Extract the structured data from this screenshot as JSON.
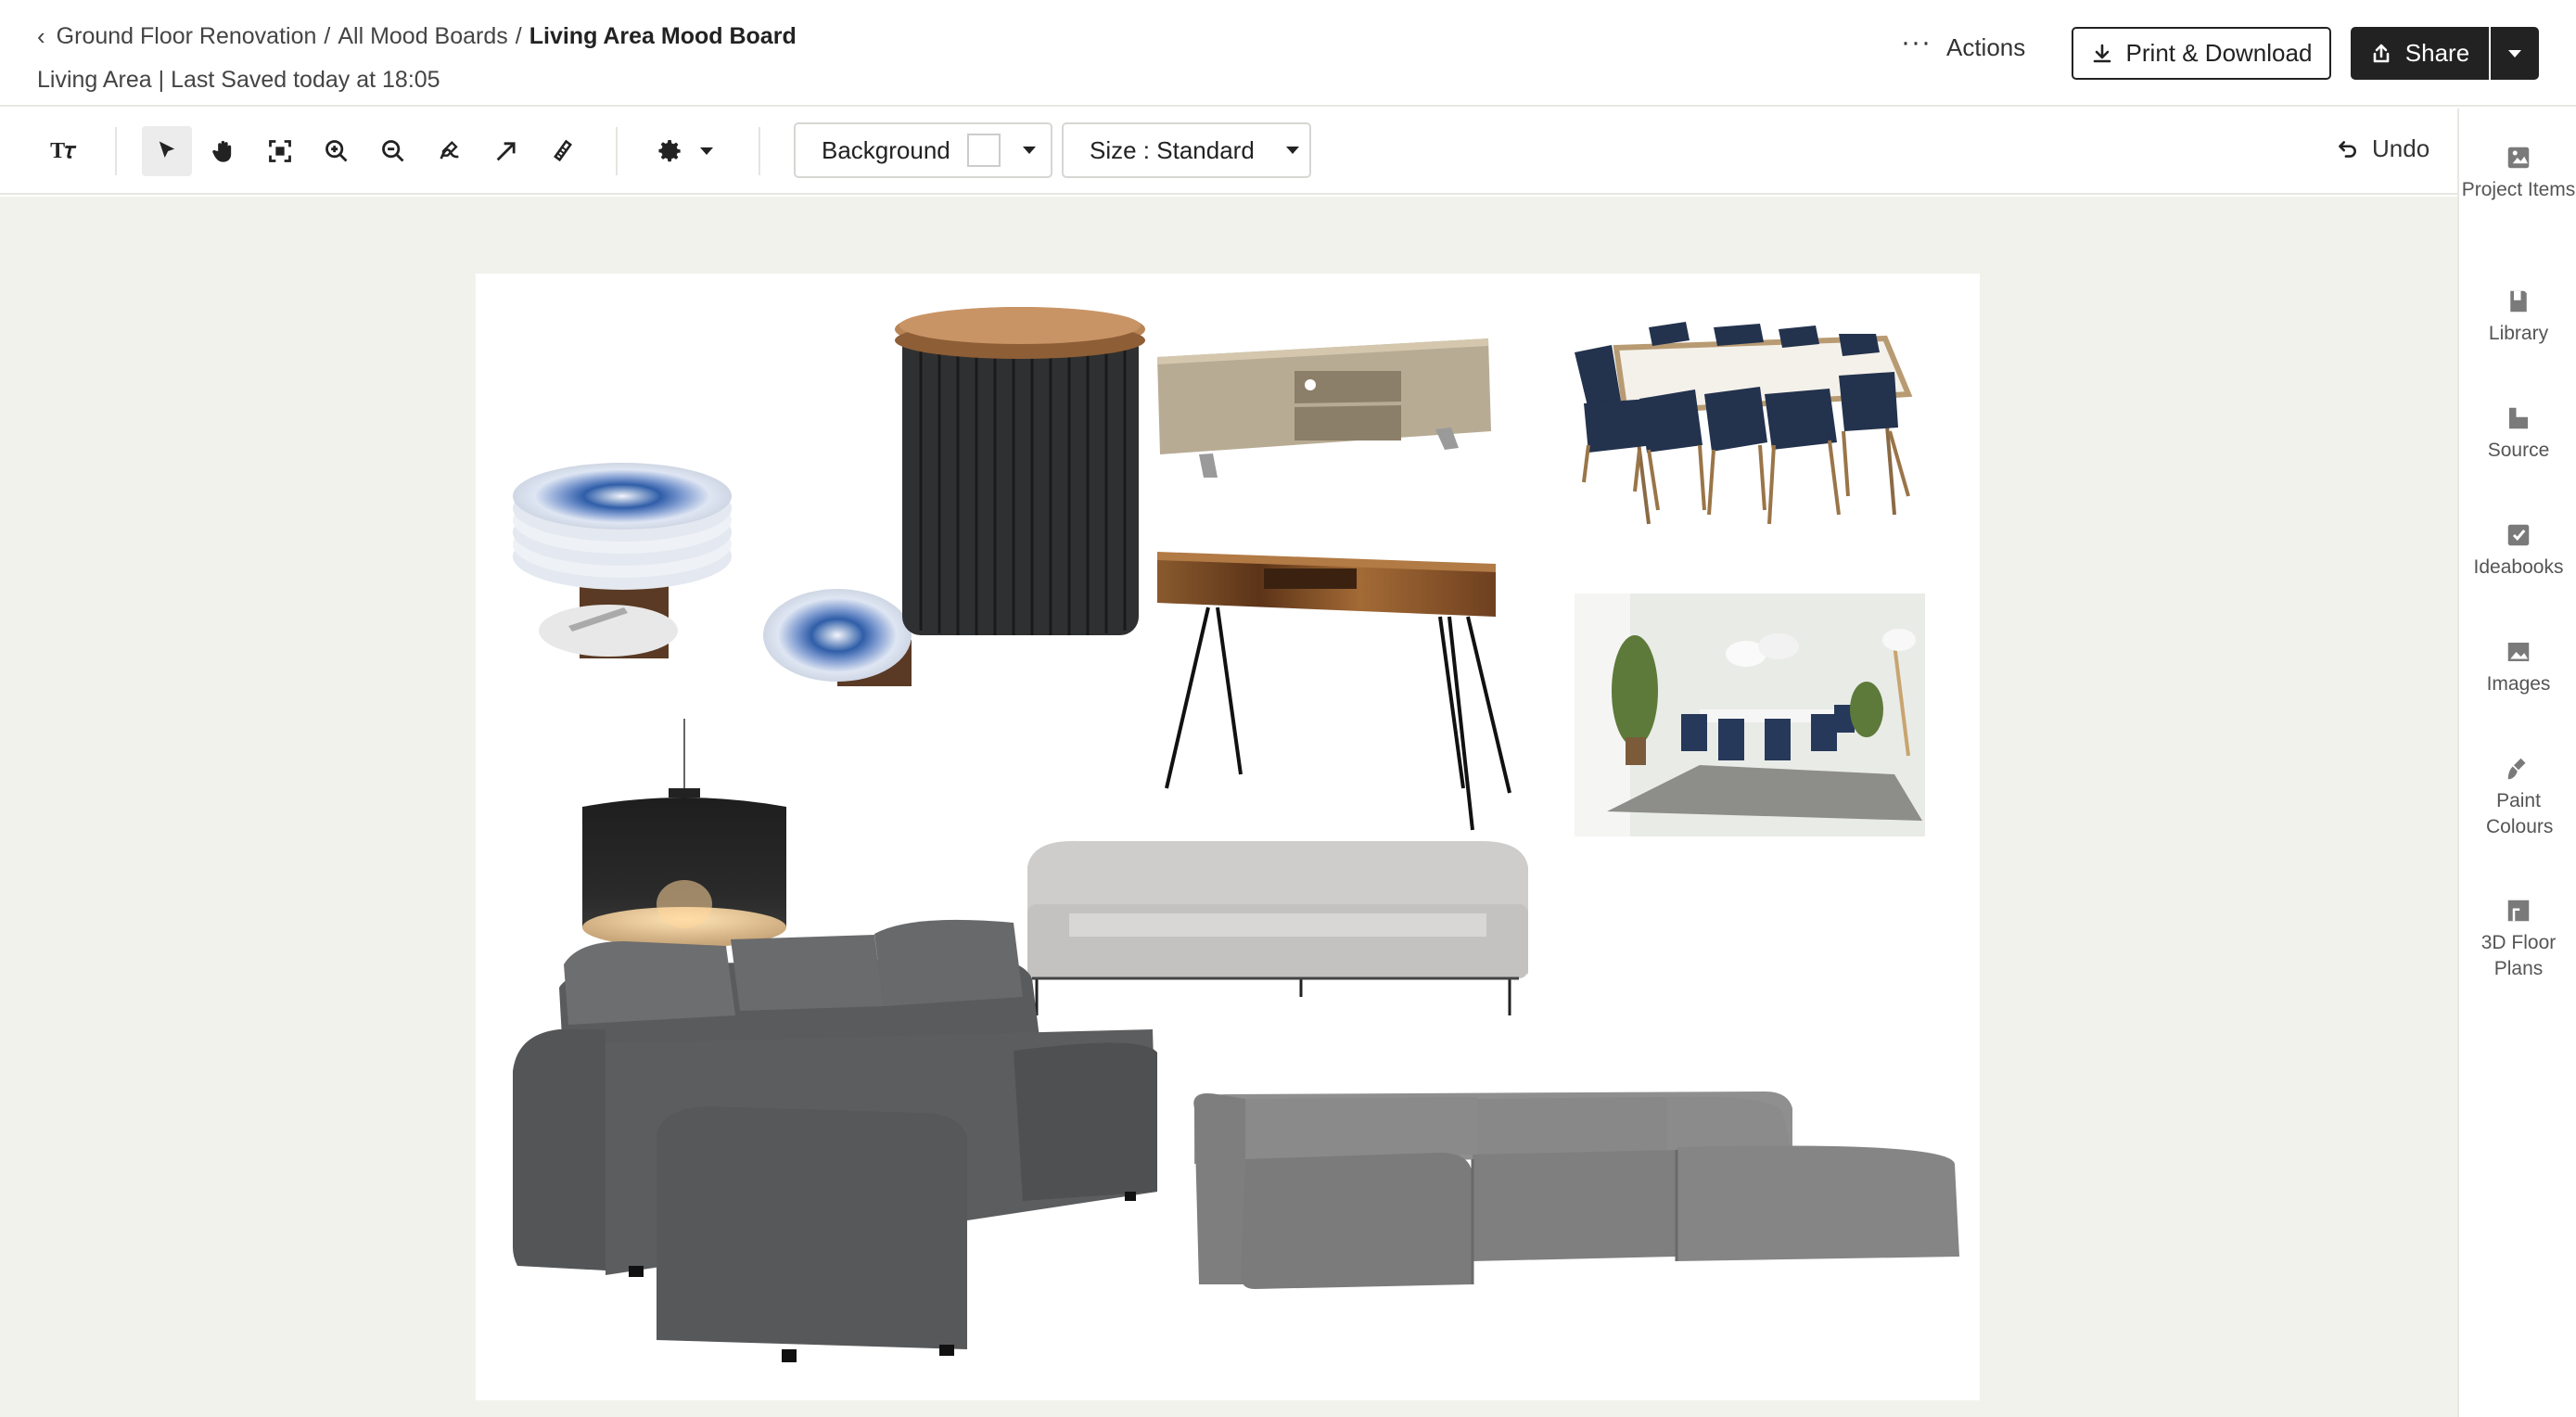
{
  "header": {
    "breadcrumbs": [
      "Ground Floor Renovation",
      "All Mood Boards"
    ],
    "current": "Living Area Mood Board",
    "subline": "Living Area | Last Saved today at 18:05",
    "actions_label": "Actions",
    "print_label": "Print & Download",
    "share_label": "Share"
  },
  "toolbar": {
    "background_label": "Background",
    "size_label": "Size : Standard",
    "undo_label": "Undo",
    "tools": [
      "text-tool",
      "select-tool",
      "pan-tool",
      "fit-screen-tool",
      "zoom-in-tool",
      "zoom-out-tool",
      "draw-tool",
      "arrow-tool",
      "eraser-tool",
      "settings-tool"
    ]
  },
  "sidebar": {
    "items": [
      {
        "label": "Project Items",
        "icon": "project-items-icon"
      },
      {
        "label": "Library",
        "icon": "library-icon"
      },
      {
        "label": "Source",
        "icon": "source-icon"
      },
      {
        "label": "Ideabooks",
        "icon": "ideabooks-icon"
      },
      {
        "label": "Images",
        "icon": "images-icon"
      },
      {
        "label": "Paint Colours",
        "icon": "paint-brush-icon"
      },
      {
        "label": "3D Floor Plans",
        "icon": "floor-plan-icon"
      }
    ]
  },
  "board": {
    "items": [
      "blue-plates",
      "slatted-side-table",
      "tv-stand",
      "dining-set",
      "wooden-console-table",
      "dining-room-photo",
      "pendant-lamp",
      "grey-three-seat-sofa",
      "dark-grey-corner-sofa",
      "modular-grey-sofa"
    ]
  },
  "colors": {
    "canvas_bg": "#f2f2ed",
    "primary_button": "#222222",
    "border": "#e7e7e2"
  }
}
